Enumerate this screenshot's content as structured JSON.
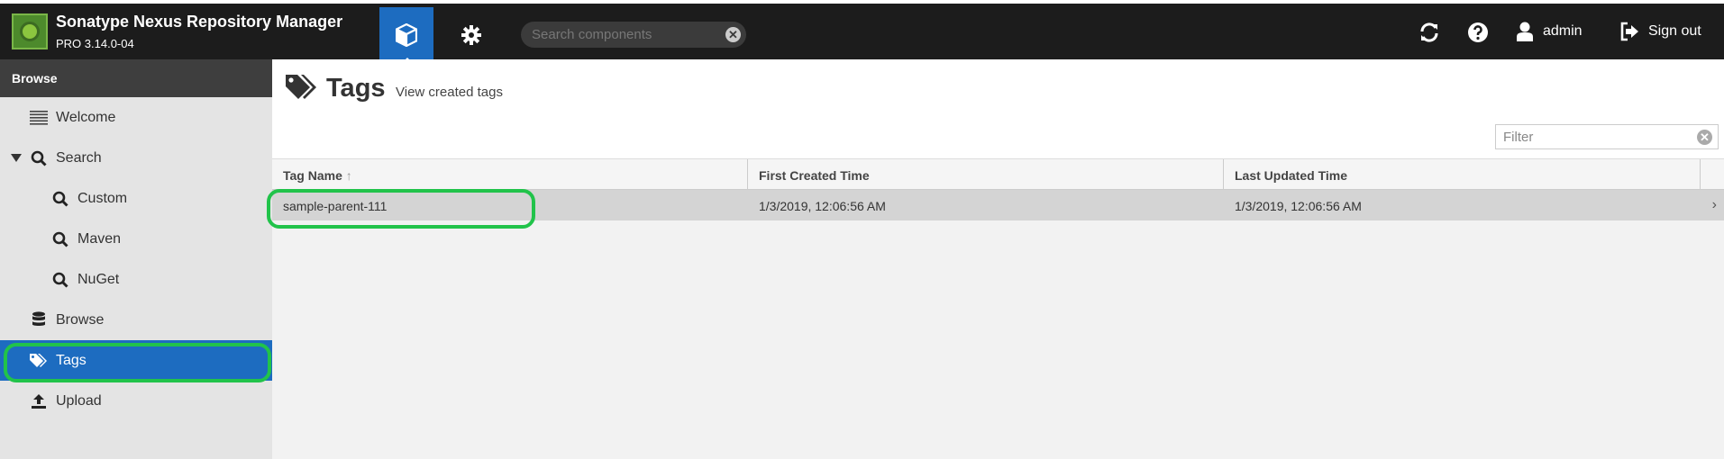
{
  "app": {
    "title": "Sonatype Nexus Repository Manager",
    "version": "PRO 3.14.0-04"
  },
  "header": {
    "search_placeholder": "Search components",
    "user_name": "admin",
    "signout_label": "Sign out",
    "clear_icon": "✕"
  },
  "sidebar": {
    "title": "Browse",
    "items": [
      {
        "label": "Welcome",
        "icon": "list-icon"
      },
      {
        "label": "Search",
        "icon": "search-icon"
      },
      {
        "label": "Custom",
        "icon": "search-icon"
      },
      {
        "label": "Maven",
        "icon": "search-icon"
      },
      {
        "label": "NuGet",
        "icon": "search-icon"
      },
      {
        "label": "Browse",
        "icon": "database-icon"
      },
      {
        "label": "Tags",
        "icon": "tags-icon",
        "active": true
      },
      {
        "label": "Upload",
        "icon": "upload-icon"
      }
    ]
  },
  "page": {
    "title": "Tags",
    "subtitle": "View created tags",
    "filter_placeholder": "Filter"
  },
  "table": {
    "columns": [
      "Tag Name",
      "First Created Time",
      "Last Updated Time"
    ],
    "sort_indicator": "↑",
    "rows": [
      {
        "tag_name": "sample-parent-111",
        "first_created": "1/3/2019, 12:06:56 AM",
        "last_updated": "1/3/2019, 12:06:56 AM"
      }
    ],
    "row_chevron": "›"
  },
  "colors": {
    "accent": "#1d6cc0",
    "highlight": "#21c34a",
    "topbar": "#1c1c1c"
  }
}
